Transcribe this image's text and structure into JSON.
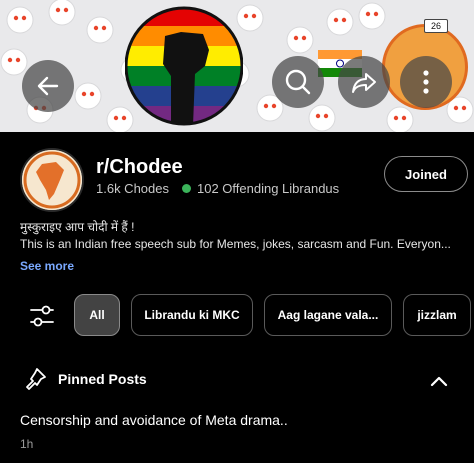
{
  "banner": {
    "device_badge": "26"
  },
  "subreddit": {
    "name": "r/Chodee",
    "members": "1.6k Chodes",
    "online": "102 Offending Librandus",
    "join_label": "Joined",
    "description_line1": "मुस्कुराइए आप चोदी में हैं !",
    "description_line2": "This is an Indian free speech sub for Memes, jokes, sarcasm and Fun. Everyon...",
    "see_more": "See more"
  },
  "filters": {
    "chips": [
      "All",
      "Librandu ki MKC",
      "Aag lagane vala...",
      "jizzlam"
    ],
    "active": "All"
  },
  "pinned": {
    "title": "Pinned Posts",
    "post_title": "Censorship and avoidance of Meta drama..",
    "post_age": "1h"
  },
  "colors": {
    "accent_link": "#7aa9ff",
    "online": "#3bb35a"
  },
  "icons": [
    "back-arrow-icon",
    "search-icon",
    "share-icon",
    "more-icon",
    "filter-icon",
    "pin-icon",
    "chevron-up-icon",
    "raised-fist-icon"
  ]
}
